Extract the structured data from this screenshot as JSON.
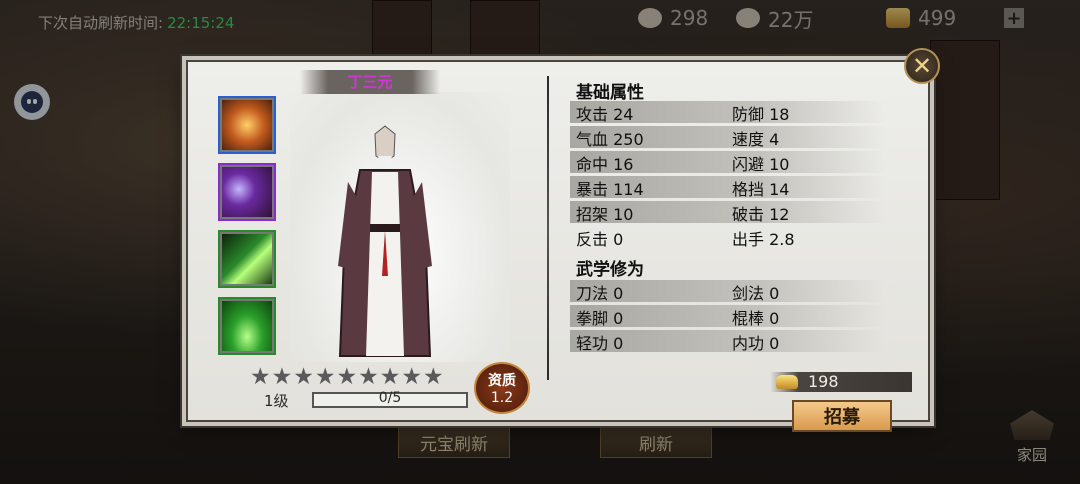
{
  "header": {
    "refresh_label": "下次自动刷新时间:",
    "refresh_time": "22:15:24",
    "resources": [
      {
        "icon": "bun-icon",
        "value": "298"
      },
      {
        "icon": "silver-icon",
        "value": "22万"
      },
      {
        "icon": "gold-ingot-icon",
        "value": "499"
      }
    ],
    "plus": "+"
  },
  "bottom": {
    "yuanbao_refresh": "元宝刷新",
    "refresh": "刷新",
    "home": "家园"
  },
  "dialog": {
    "close": "✕",
    "character_name": "丁三元",
    "stars": [
      "★",
      "★",
      "★",
      "★",
      "★",
      "★",
      "★",
      "★",
      "★"
    ],
    "level": "1级",
    "exp": "0/5",
    "aptitude_label": "资质",
    "aptitude_value": "1.2",
    "base_title": "基础属性",
    "base_stats": [
      {
        "left": "攻击 24",
        "right": "防御 18"
      },
      {
        "left": "气血 250",
        "right": "速度 4"
      },
      {
        "left": "命中 16",
        "right": "闪避 10"
      },
      {
        "left": "暴击 114",
        "right": "格挡 14"
      },
      {
        "left": "招架 10",
        "right": "破击 12"
      },
      {
        "left": "反击 0",
        "right": "出手 2.8"
      }
    ],
    "martial_title": "武学修为",
    "martial_stats": [
      {
        "left": "刀法 0",
        "right": "剑法 0"
      },
      {
        "left": "拳脚 0",
        "right": "棍棒 0"
      },
      {
        "left": "轻功 0",
        "right": "内功 0"
      }
    ],
    "price": "198",
    "recruit": "招募"
  },
  "colors": {
    "name": "#d633d6",
    "timer": "#3fd46a",
    "button": "#e8b06a"
  }
}
